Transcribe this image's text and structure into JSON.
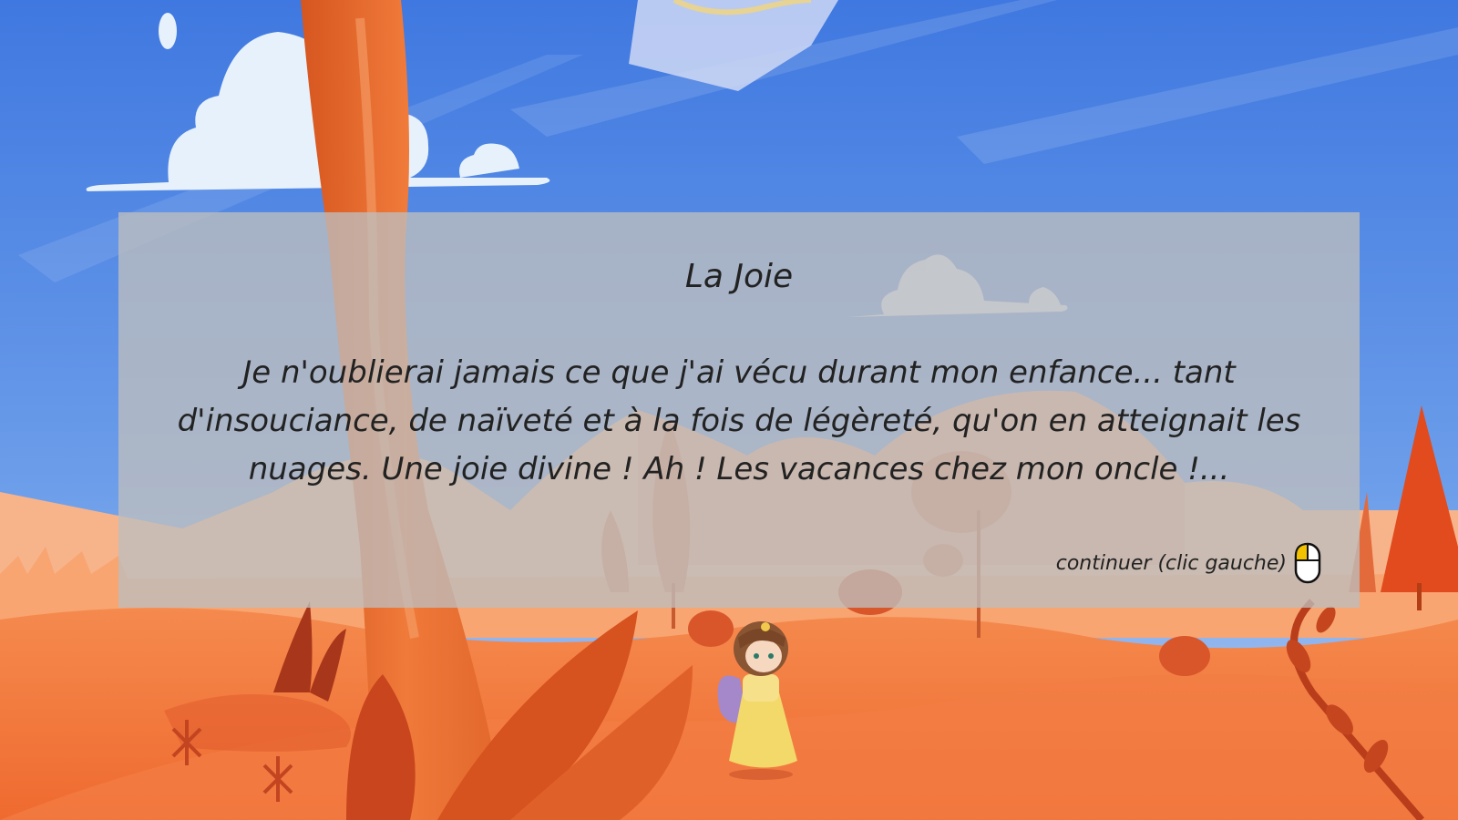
{
  "dialogue": {
    "speaker": "La Joie",
    "text": "Je n'oublierai jamais ce que j'ai vécu durant mon enfance... tant d'insouciance, de naïveté et à la fois de légèreté, qu'on en atteignait les nuages. Une joie divine ! Ah ! Les vacances chez mon oncle !...",
    "continue_label": "continuer (clic gauche)",
    "continue_icon": "mouse-left-click-icon"
  },
  "colors": {
    "sky_top": "#3f78e0",
    "sky_bottom": "#8fb8f0",
    "ground": "#f26b35",
    "tree_trunk": "#e8682e",
    "dialog_panel": "#bebebe",
    "text": "#222222",
    "mouse_highlight": "#f2c200"
  }
}
